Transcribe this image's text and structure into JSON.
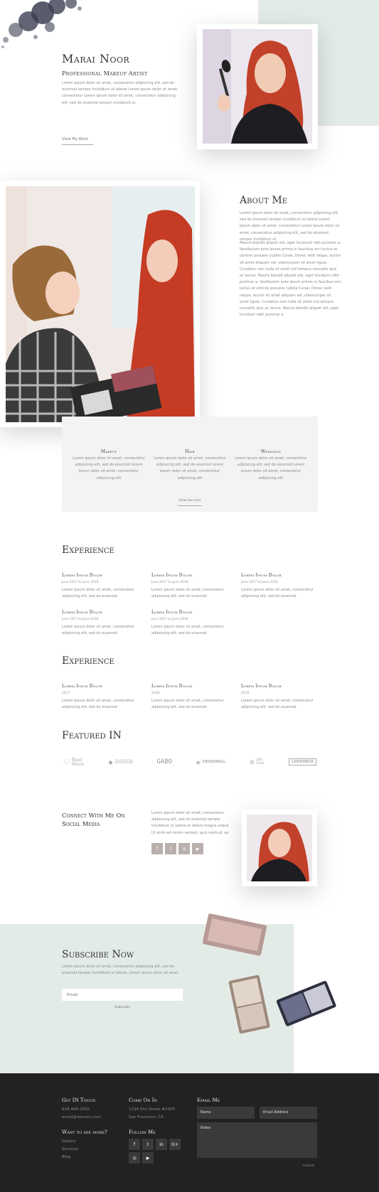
{
  "hero": {
    "name": "Marai Noor",
    "subtitle": "Professional Makeup Artist",
    "text": "Lorem ipsum dolor sit amet, consectetur adipiscing elit, sed do eiusmod tempor incididunt ut labore Lorem ipsum dolor sit amet, consectetur Lorem ipsum dolor sit amet, consectetur adipiscing elit, sed do eiusmod tempor incididunt ut.",
    "cta": "View My Work"
  },
  "about": {
    "title": "About Me",
    "p1": "Lorem ipsum dolor sit amet, consectetur adipiscing elit, sed do eiusmod tempor incididunt ut labore Lorem ipsum dolor sit amet, consectetur Lorem ipsum dolor sit amet, consectetur adipiscing elit, sed do eiusmod tempor incididunt ut.",
    "p2": "Mauris blandit aliquet elit, eget tincidunt nibh pulvinar a. Vestibulum ante ipsum primis in faucibus orci luctus et ultrices posuere cubilia Curae; Donec velit neque, auctor sit amet aliquam vel, ullamcorper sit amet ligula. Curabitur non nulla sit amet nisl tempus convallis quis ac lectus. Mauris blandit aliquet elit, eget tincidunt nibh pulvinar a. Vestibulum ante ipsum primis in faucibus orci luctus et ultrices posuere cubilia Curae; Donec velit neque, auctor sit amet aliquam vel, ullamcorper sit amet ligula. Curabitur non nulla sit amet nisl tempus convallis quis ac lectus. Mauris blandit aliquet elit, eget tincidunt nibh pulvinar a."
  },
  "services": {
    "items": [
      {
        "title": "Makeup",
        "text": "Lorem ipsum dolor sit amet, consectetur adipiscing elit, sed do eiusmod Lorem ipsum dolor sit amet, consectetur adipiscing elit"
      },
      {
        "title": "Hair",
        "text": "Lorem ipsum dolor sit amet, consectetur adipiscing elit, sed do eiusmod Lorem ipsum dolor sit amet, consectetur adipiscing elit"
      },
      {
        "title": "Weddings",
        "text": "Lorem ipsum dolor sit amet, consectetur adipiscing elit, sed do eiusmod Lorem ipsum dolor sit amet, consectetur adipiscing elit"
      }
    ],
    "cta": "View Services"
  },
  "experience1": {
    "title": "Experience",
    "items": [
      {
        "title": "Lorem Ipsum Dolor",
        "date": "June 2017 to June 2018",
        "text": "Lorem ipsum dolor sit amet, consectetur adipiscing elit, sed do eiusmod."
      },
      {
        "title": "Lorem Ipsum Dolor",
        "date": "June 2017 to June 2018",
        "text": "Lorem ipsum dolor sit amet, consectetur adipiscing elit, sed do eiusmod."
      },
      {
        "title": "Lorem Ipsum Dolor",
        "date": "June 2017 to June 2018",
        "text": "Lorem ipsum dolor sit amet, consectetur adipiscing elit, sed do eiusmod."
      },
      {
        "title": "Lorem Ipsum Dolor",
        "date": "June 2017 to June 2018",
        "text": "Lorem ipsum dolor sit amet, consectetur adipiscing elit, sed do eiusmod."
      },
      {
        "title": "Lorem Ipsum Dolor",
        "date": "June 2017 to June 2018",
        "text": "Lorem ipsum dolor sit amet, consectetur adipiscing elit, sed do eiusmod."
      }
    ]
  },
  "experience2": {
    "title": "Experience",
    "items": [
      {
        "title": "Lorem Ipsum Dolor",
        "date": "2017",
        "text": "Lorem ipsum dolor sit amet, consectetur adipiscing elit, sed do eiusmod."
      },
      {
        "title": "Lorem Ipsum Dolor",
        "date": "2018",
        "text": "Lorem ipsum dolor sit amet, consectetur adipiscing elit, sed do eiusmod."
      },
      {
        "title": "Lorem Ipsum Dolor",
        "date": "2018",
        "text": "Lorem ipsum dolor sit amet, consectetur adipiscing elit, sed do eiusmod."
      }
    ]
  },
  "featured": {
    "title": "Featured IN",
    "logos": [
      "Real Wave",
      "INNER",
      "GABO",
      "CROSSWILL",
      "Job Line",
      "LOUDNECK"
    ]
  },
  "connect": {
    "title": "Connect With Me On Social Media",
    "text": "Lorem ipsum dolor sit amet, consectetur adipiscing elit, sed do eiusmod tempor incididunt ut labore et dolore magna aliqua Ut enim ad minim veniam, quis nostrud. ex.",
    "icons": [
      "f",
      "t",
      "◎",
      "▶"
    ]
  },
  "subscribe": {
    "title": "Subscribe Now",
    "text": "Lorem ipsum dolor sit amet, consectetur adipiscing elit, sed do eiusmod tempor incididunt ut labore. Lorem ipsum dolor sit amet",
    "placeholder": "Email",
    "button": "Subscribe"
  },
  "footer": {
    "touch_title": "Get IN Touch",
    "phone": "618-466-2592",
    "email": "email@domain.com",
    "more_title": "Want to see more?",
    "links": [
      "Gallery",
      "Services",
      "Blog"
    ],
    "come_title": "Come On In",
    "addr1": "1234 Divi Street #1000",
    "addr2": "San Francisco, CA",
    "follow_title": "Follow Me",
    "follow_row1": [
      "f",
      "t",
      "in",
      "G+"
    ],
    "follow_row2": [
      "◎",
      "▶"
    ],
    "email_title": "Email Me",
    "name_ph": "Name",
    "email_ph": "Email Address",
    "notes_ph": "Notes",
    "submit": "Submit"
  },
  "colors": {
    "mint": "#e3ebe7",
    "grey_panel": "#f3f3f3",
    "footer": "#222222",
    "social": "#b9b0ad"
  }
}
